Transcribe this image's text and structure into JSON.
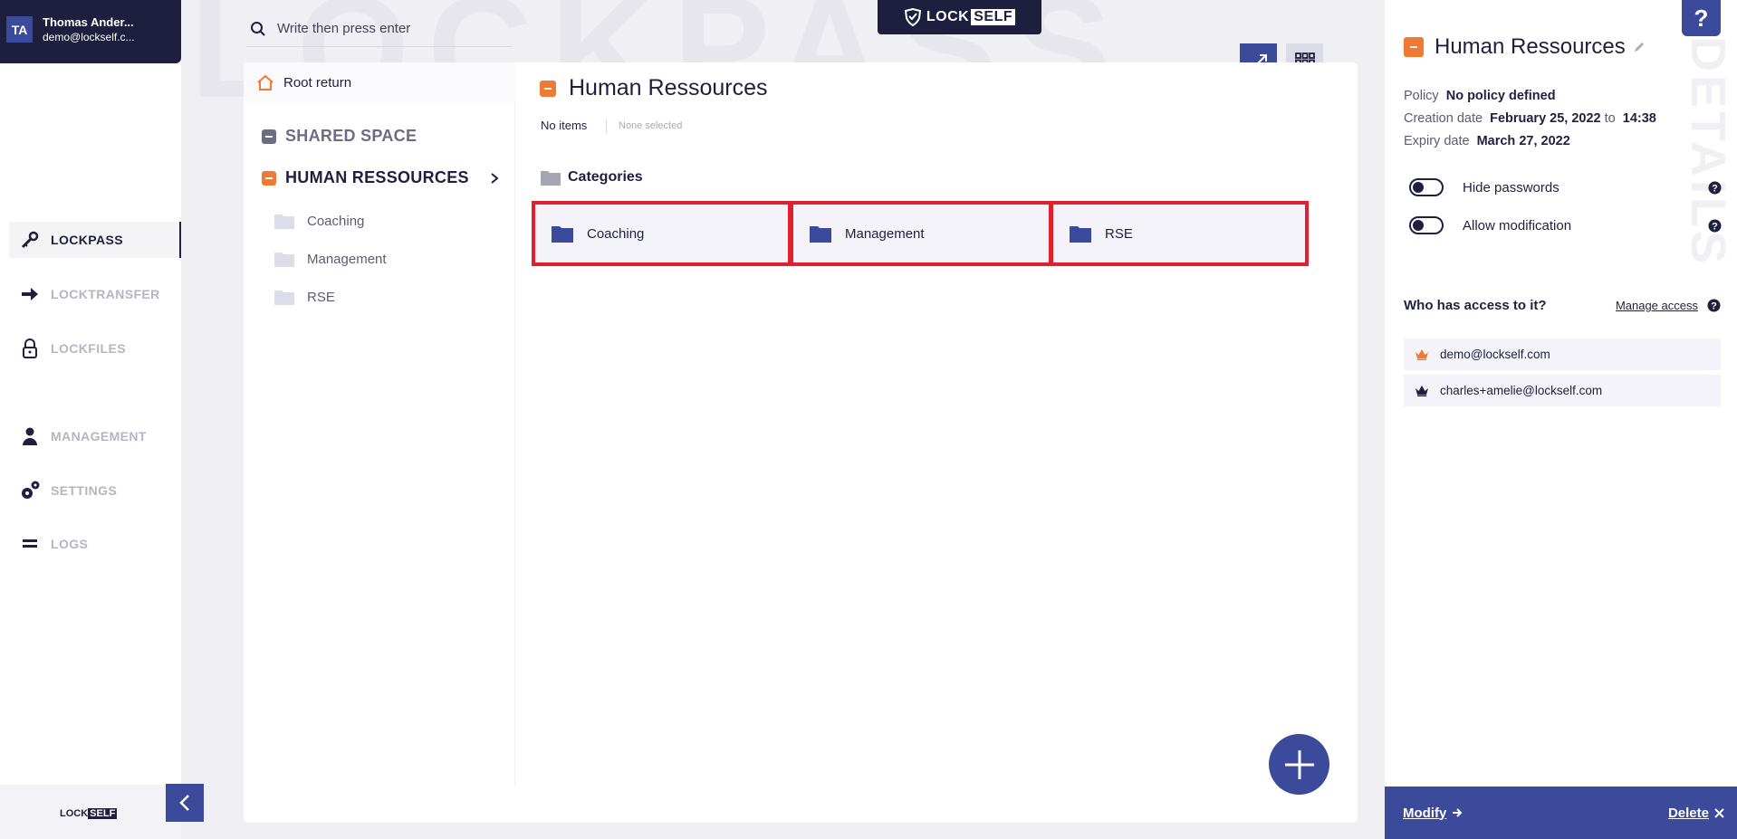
{
  "user": {
    "initials": "TA",
    "name": "Thomas Ander...",
    "email": "demo@lockself.c..."
  },
  "nav": [
    {
      "label": "LOCKPASS",
      "icon": "key-icon",
      "active": true
    },
    {
      "label": "LOCKTRANSFER",
      "icon": "arrow-right-icon",
      "active": false
    },
    {
      "label": "LOCKFILES",
      "icon": "lock-icon",
      "active": false
    },
    {
      "label": "MANAGEMENT",
      "icon": "person-icon",
      "active": false
    },
    {
      "label": "SETTINGS",
      "icon": "gears-icon",
      "active": false
    },
    {
      "label": "LOGS",
      "icon": "list-icon",
      "active": false
    }
  ],
  "brand": {
    "lock": "LOCK",
    "self": "SELF",
    "watermark": "LOCKPASS",
    "details_watermark": "DETAILS"
  },
  "search": {
    "placeholder": "Write then press enter"
  },
  "tree": {
    "root_return": "Root return",
    "shared_space": "SHARED SPACE",
    "human_resources": "HUMAN RESSOURCES",
    "subfolders": [
      "Coaching",
      "Management",
      "RSE"
    ]
  },
  "content": {
    "title": "Human Ressources",
    "items_count": "No items",
    "selection": "None selected",
    "categories_label": "Categories",
    "categories": [
      "Coaching",
      "Management",
      "RSE"
    ]
  },
  "details": {
    "help": "?",
    "title": "Human Ressources",
    "policy_label": "Policy",
    "policy_value": "No policy defined",
    "creation_label": "Creation date",
    "creation_value": "February 25, 2022",
    "creation_to": "to",
    "creation_time": "14:38",
    "expiry_label": "Expiry date",
    "expiry_value": "March 27, 2022",
    "hide_passwords": "Hide passwords",
    "allow_modification": "Allow modification",
    "access_question": "Who has access to it?",
    "manage_access": "Manage access",
    "access_list": [
      "demo@lockself.com",
      "charles+amelie@lockself.com"
    ],
    "modify": "Modify",
    "delete": "Delete"
  },
  "colors": {
    "navy": "#1e1f3f",
    "accent": "#3c4a9b",
    "orange": "#f07a34",
    "highlight": "#e0202f"
  }
}
